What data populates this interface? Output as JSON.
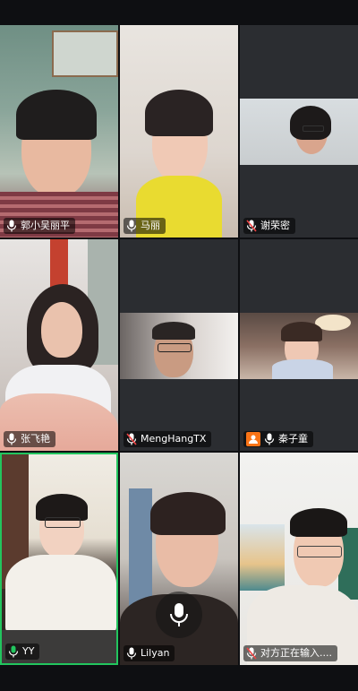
{
  "participants": [
    {
      "name": "郭小吴丽平",
      "mic": "on"
    },
    {
      "name": "马丽",
      "mic": "on"
    },
    {
      "name": "谢荣密",
      "mic": "muted"
    },
    {
      "name": "张飞艳",
      "mic": "on"
    },
    {
      "name": "MengHangTX",
      "mic": "muted"
    },
    {
      "name": "秦子童",
      "mic": "on"
    },
    {
      "name": "YY",
      "mic": "on",
      "speaking": true
    },
    {
      "name": "Lilyan",
      "mic": "on"
    },
    {
      "name": "对方正在输入....",
      "mic": "muted"
    }
  ],
  "colors": {
    "active_border": "#22c55e",
    "muted_mic": "#ef4444",
    "avatar_badge": "#f97316",
    "tile_bg": "#2b2d31"
  }
}
